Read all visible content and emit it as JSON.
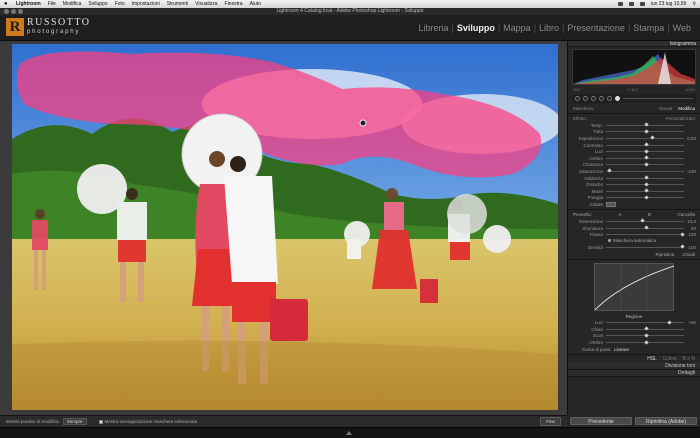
{
  "menubar": {
    "app": "Lightroom",
    "items": [
      "File",
      "Modifica",
      "Sviluppo",
      "Foto",
      "Impostazioni",
      "Strumenti",
      "Visualizza",
      "Finestra",
      "Aiuto"
    ],
    "clock": "lun 23 lug  10.59"
  },
  "window": {
    "title": "Lightroom 4 Catalog.lrcat - Adobe Photoshop Lightroom - Sviluppo"
  },
  "identity": {
    "mark": "R",
    "name": "RUSSOTTO",
    "tagline": "photography"
  },
  "modules": [
    "Libreria",
    "Sviluppo",
    "Mappa",
    "Libro",
    "Presentazione",
    "Stampa",
    "Web"
  ],
  "active_module": "Sviluppo",
  "panel": {
    "histogram_title": "Istogramma",
    "histogram_info": [
      "ISO",
      "f / 6.3",
      "1/160"
    ],
    "mask": {
      "label": "Maschera:",
      "new": "Nuova",
      "edit": "Modifica"
    },
    "effect": {
      "label": "Effetto:",
      "preset": "Personalizzato"
    },
    "sliders": [
      {
        "label": "Temp.",
        "val": ""
      },
      {
        "label": "Tinta",
        "val": ""
      },
      {
        "label": "Esposizione",
        "val": "0,50"
      },
      {
        "label": "Contrasto",
        "val": ""
      },
      {
        "label": "Luci",
        "val": ""
      },
      {
        "label": "Ombre",
        "val": ""
      },
      {
        "label": "Chiarezza",
        "val": ""
      },
      {
        "label": "Saturazione",
        "val": "-100"
      },
      {
        "label": "Nitidezza",
        "val": ""
      },
      {
        "label": "Disturbo",
        "val": ""
      },
      {
        "label": "Moiré",
        "val": ""
      },
      {
        "label": "Frangia",
        "val": ""
      }
    ],
    "color_label": "Colore",
    "brush": {
      "label": "Pennello:",
      "a": "A",
      "b": "B",
      "erase": "Cancella"
    },
    "brush_sliders": [
      {
        "label": "Dimensione",
        "val": "10,0"
      },
      {
        "label": "Sfumatura",
        "val": "50"
      },
      {
        "label": "Flusso",
        "val": "100"
      }
    ],
    "automask": "Maschera automatica",
    "density": {
      "label": "Densità",
      "val": "100"
    },
    "reset": "Ripristina",
    "close": "Chiudi",
    "curve_sub": "Regione",
    "curve_labels": [
      "Luci",
      "Chiari",
      "Scuri",
      "Ombre"
    ],
    "curve_vals": [
      "+60",
      "",
      "",
      ""
    ],
    "point_curve": {
      "label": "Curva di punti:",
      "value": "Lineare"
    },
    "hsl_tabs": [
      "HSL",
      "Colore",
      "B e N"
    ],
    "split_toning": "Divisione toni",
    "details": "Dettagli"
  },
  "toolbar": {
    "overlay_label": "Mostra puntine di modifica:",
    "overlay_value": "Sempre",
    "show_mask": "Mostra sovrapposizione maschera selezionata",
    "done": "Fine"
  },
  "buttons": {
    "prev": "Precedente",
    "reset_adobe": "Ripristina (Adobe)"
  }
}
